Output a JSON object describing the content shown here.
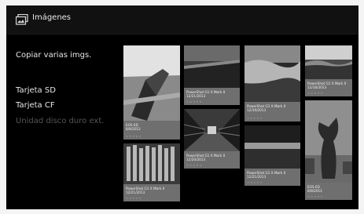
{
  "header": {
    "title": "Imágenes",
    "icon": "images-icon"
  },
  "menu": {
    "items": [
      {
        "label": "Copiar varias imgs."
      },
      {
        "label": "Tarjeta SD"
      },
      {
        "label": "Tarjeta CF"
      },
      {
        "label": "Unidad disco duro ext.",
        "disabled": true
      }
    ]
  },
  "photos": [
    {
      "camera": "EOS 6D",
      "date": "8/8/2012",
      "rating": "★★★★★"
    },
    {
      "camera": "PowerShot G1 X Mark II",
      "date": "12/21/2013",
      "rating": "★★★★★"
    },
    {
      "camera": "PowerShot G1 X Mark II",
      "date": "12/19/2013",
      "rating": "★★★★★"
    },
    {
      "camera": "PowerShot G1 X Mark II",
      "date": "12/18/2013",
      "rating": "★★★★★"
    },
    {
      "camera": "PowerShot G1 X Mark II",
      "date": "12/20/2013",
      "rating": "★★★★★"
    },
    {
      "camera": "PowerShot G1 X Mark II",
      "date": "12/21/2013",
      "rating": "★★★★★"
    },
    {
      "camera": "PowerShot G1 X Mark II",
      "date": "12/21/2013",
      "rating": "★★★★★"
    },
    {
      "camera": "EOS 6D",
      "date": "8/8/2012",
      "rating": "★★★★★"
    }
  ]
}
